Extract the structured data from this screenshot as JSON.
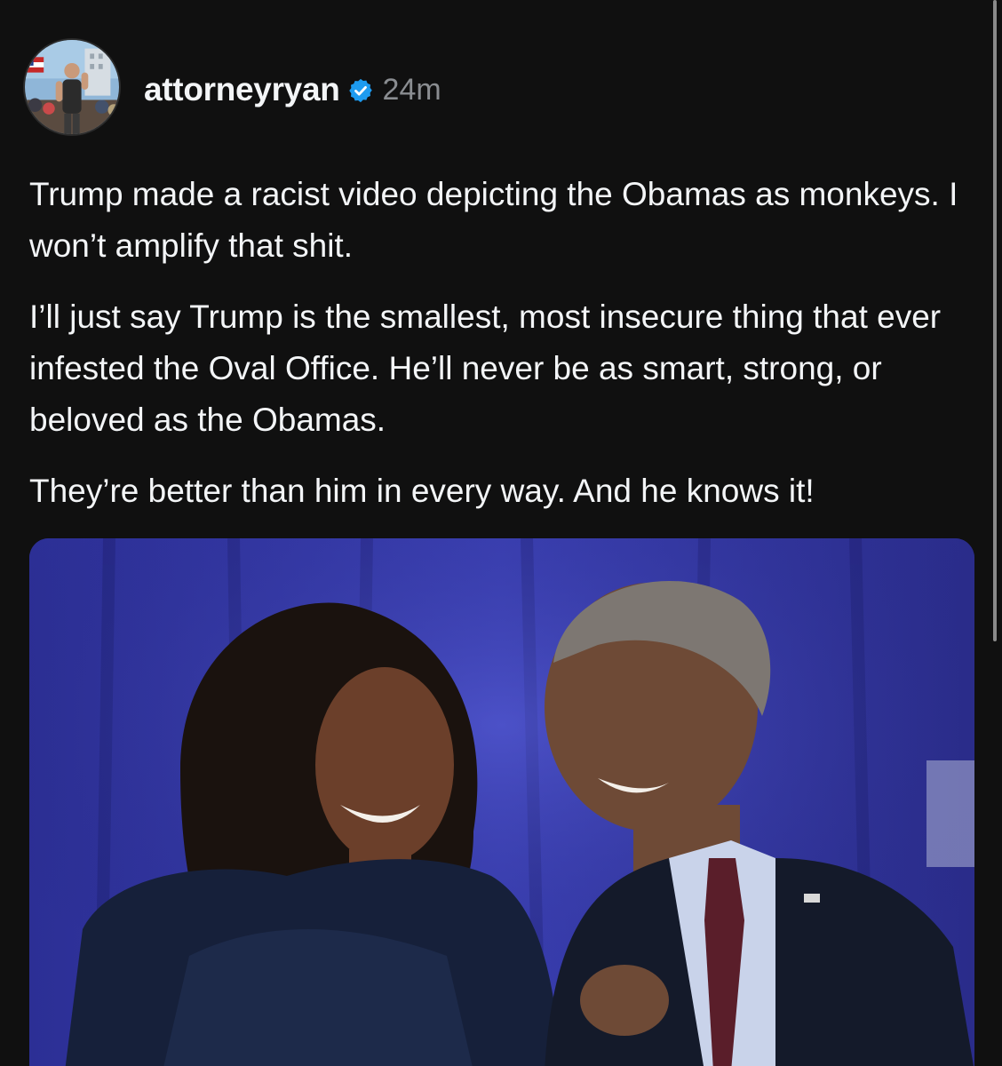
{
  "post": {
    "username": "attorneyryan",
    "timestamp": "24m",
    "paragraphs": [
      "Trump made a racist video depicting the Obamas as monkeys. I won’t amplify that shit.",
      "I’ll just say Trump is the smallest, most insecure thing that ever infested the Oval Office. He’ll never be as smart, strong, or beloved as the Obamas.",
      "They’re better than him in every way. And he knows it!"
    ]
  },
  "icons": {
    "verified": "verified-badge-icon"
  },
  "colors": {
    "background": "#101010",
    "text": "#f3f5f7",
    "muted": "#8a8d91",
    "verified": "#1d9bf0"
  }
}
